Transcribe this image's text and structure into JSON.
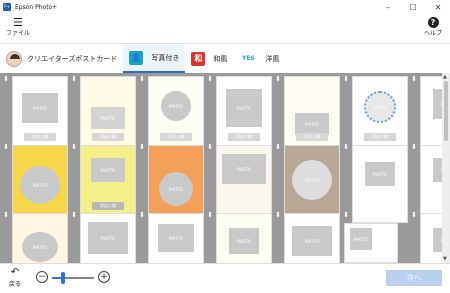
{
  "titlebar": {
    "title": "Epson Photo+",
    "icon": "app-icon",
    "icon_label": "P+"
  },
  "window_controls": [
    "minimize-icon",
    "maximize-icon",
    "close-icon"
  ],
  "toolbar": {
    "file_label": "ファイル",
    "help_label": "ヘルプ"
  },
  "category": {
    "label": "クリエイターズポストカード"
  },
  "tabs": [
    {
      "label": "写真付き",
      "icon": "photo-person-icon",
      "color": "#1aa0c8",
      "glyph": "👤",
      "active": true
    },
    {
      "label": "和風",
      "icon": "wa-icon",
      "color": "#d9352b",
      "glyph": "和",
      "active": false
    },
    {
      "label": "洋風",
      "icon": "yes-icon",
      "color": "#2d9ad9",
      "glyph": "YES",
      "active": false
    }
  ],
  "cards": {
    "photo_label": "PHOTO",
    "button_label": "思出入稿"
  },
  "footer": {
    "back_label": "戻る",
    "next_label": "次へ",
    "zoom_level": 0.3
  },
  "colors": {
    "accent": "#2e6fd0",
    "grid_bg": "#9a9a9a"
  }
}
